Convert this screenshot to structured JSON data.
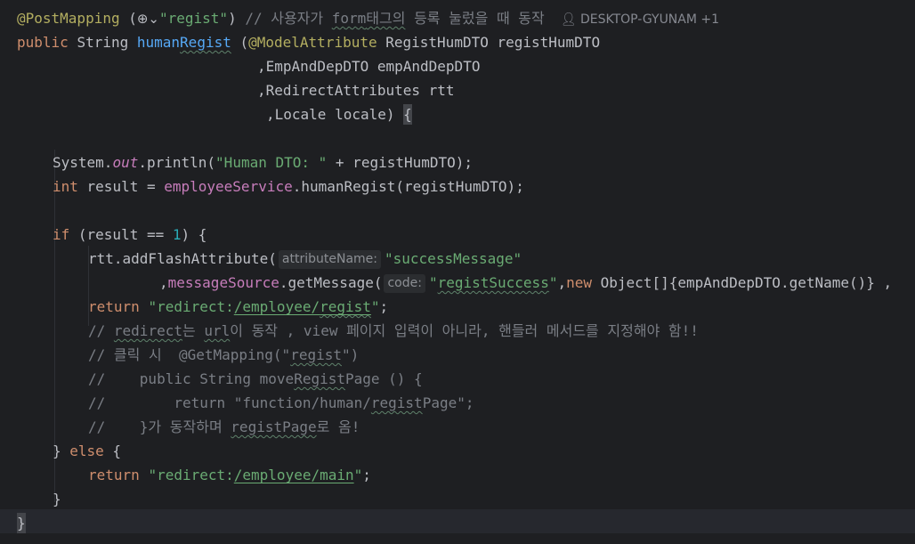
{
  "editor": {
    "author_text": "DESKTOP-GYUNAM +1",
    "inlay_hints": {
      "attribute_name": "attributeName:",
      "code": "code:"
    },
    "lines": [
      "@PostMapping (\"regist\") // 사용자가 form태그의 등록 눌렀을 때 동작",
      "public String humanRegist (@ModelAttribute RegistHumDTO registHumDTO",
      ",EmpAndDepDTO empAndDepDTO",
      ",RedirectAttributes rtt",
      ",Locale locale) {",
      "",
      "System.out.println(\"Human DTO: \" + registHumDTO);",
      "int result = employeeService.humanRegist(registHumDTO);",
      "",
      "if (result == 1) {",
      "rtt.addFlashAttribute(\"successMessage\"",
      ",messageSource.getMessage(\"registSuccess\",new Object[]{empAndDepDTO.getName()} ,",
      "return \"redirect:/employee/regist\";",
      "// redirect는 url이 동작 , view 페이지 입력이 아니라, 핸들러 메서드를 지정해야 함!!",
      "// 클릭 시  @GetMapping(\"regist\")",
      "//    public String moveRegistPage () {",
      "//        return \"function/human/registPage\";",
      "//    }가 동작하며 registPage로 옴!",
      "} else {",
      "return \"redirect:/employee/main\";",
      "}",
      "}"
    ],
    "tokens": {
      "l0_ann": "@PostMapping",
      "l0_str": "\"regist\"",
      "l0_cmt_a": "// 사용자가 ",
      "l0_cmt_form": "form",
      "l0_cmt_b": "태그의",
      "l0_cmt_c": " 등록 눌렀을 때 동작",
      "l1_kw": "public",
      "l1_type": "String",
      "l1_fn": "humanRegist",
      "l1_ann": "@ModelAttribute",
      "l1_rest": "RegistHumDTO registHumDTO",
      "l2": ",EmpAndDepDTO empAndDepDTO",
      "l3": ",RedirectAttributes rtt",
      "l4": ",Locale locale) ",
      "l4_brace": "{",
      "l6_a": "System.",
      "l6_out": "out",
      "l6_b": ".println(",
      "l6_str": "\"Human DTO: \"",
      "l6_c": " + registHumDTO);",
      "l7_kw": "int",
      "l7_a": " result = ",
      "l7_fld": "employeeService",
      "l7_b": ".humanRegist(registHumDTO);",
      "l9_kw": "if",
      "l9_a": " (result == ",
      "l9_num": "1",
      "l9_b": ") {",
      "l10_a": "rtt.addFlashAttribute(",
      "l10_str": "\"successMessage\"",
      "l11_a": ",",
      "l11_fld": "messageSource",
      "l11_b": ".getMessage(",
      "l11_str_q1": "\"",
      "l11_str_w": "registSuccess",
      "l11_str_q2": "\"",
      "l11_c": ",",
      "l11_kw": "new",
      "l11_d": " Object[]{empAndDepDTO.getName()} ,",
      "l12_kw": "return",
      "l12_s1": "\"redirect:",
      "l12_s2": "/employee/",
      "l12_s3": "regist",
      "l12_s4": "\"",
      "l12_end": ";",
      "l13_a": "// ",
      "l13_w1": "redirect",
      "l13_b": "는 ",
      "l13_w2": "url",
      "l13_c": "이 동작 , view 페이지 입력이 아니라, 핸들러 메서드를 지정해야 함!!",
      "l14_a": "// 클릭 시  @GetMapping(\"",
      "l14_w": "regist",
      "l14_b": "\")",
      "l15_a": "//    public String move",
      "l15_w": "Regist",
      "l15_b": "Page () {",
      "l16_a": "//        return \"function/human/",
      "l16_w": "regist",
      "l16_b": "Page\";",
      "l17_a": "//    }가 동작하며 ",
      "l17_w": "registPage",
      "l17_b": "로 옴!",
      "l18_a": "} ",
      "l18_kw": "else",
      "l18_b": " {",
      "l19_kw": "return",
      "l19_s1": "\"redirect:",
      "l19_s2": "/employee/main",
      "l19_s3": "\"",
      "l19_end": ";",
      "l20": "}",
      "l21": "}"
    }
  },
  "colors": {
    "background": "#1e1f22",
    "annotation": "#b3ae60",
    "keyword": "#cf8e6d",
    "string": "#6aab73",
    "number": "#2aacb8",
    "method_decl": "#56a8f5",
    "field": "#c77dbb",
    "comment": "#7a7e85"
  },
  "icons": [
    "globe-icon",
    "chevron-down-icon",
    "user-icon"
  ]
}
